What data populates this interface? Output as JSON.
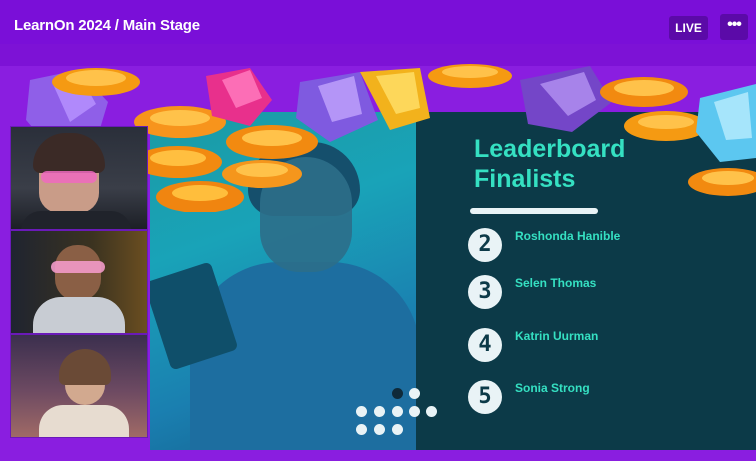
{
  "header": {
    "title": "LearnOn 2024 / Main Stage",
    "live_label": "LIVE",
    "more_icon": "more-icon",
    "more_label": "•••"
  },
  "slide": {
    "headline_line1": "Leaderboard",
    "headline_line2": "Finalists",
    "entries": [
      {
        "number": "2",
        "name": "Roshonda Hanible"
      },
      {
        "number": "3",
        "name": "Selen Thomas"
      },
      {
        "number": "4",
        "name": "Katrin Uurman"
      },
      {
        "number": "5",
        "name": "Sonia Strong"
      }
    ]
  },
  "participants": [
    {
      "id": "participant-1"
    },
    {
      "id": "participant-2"
    },
    {
      "id": "participant-3"
    }
  ],
  "colors": {
    "brand_purple": "#7a0fd8",
    "accent_teal": "#35e0c2",
    "slide_panel": "#0c3a48"
  }
}
